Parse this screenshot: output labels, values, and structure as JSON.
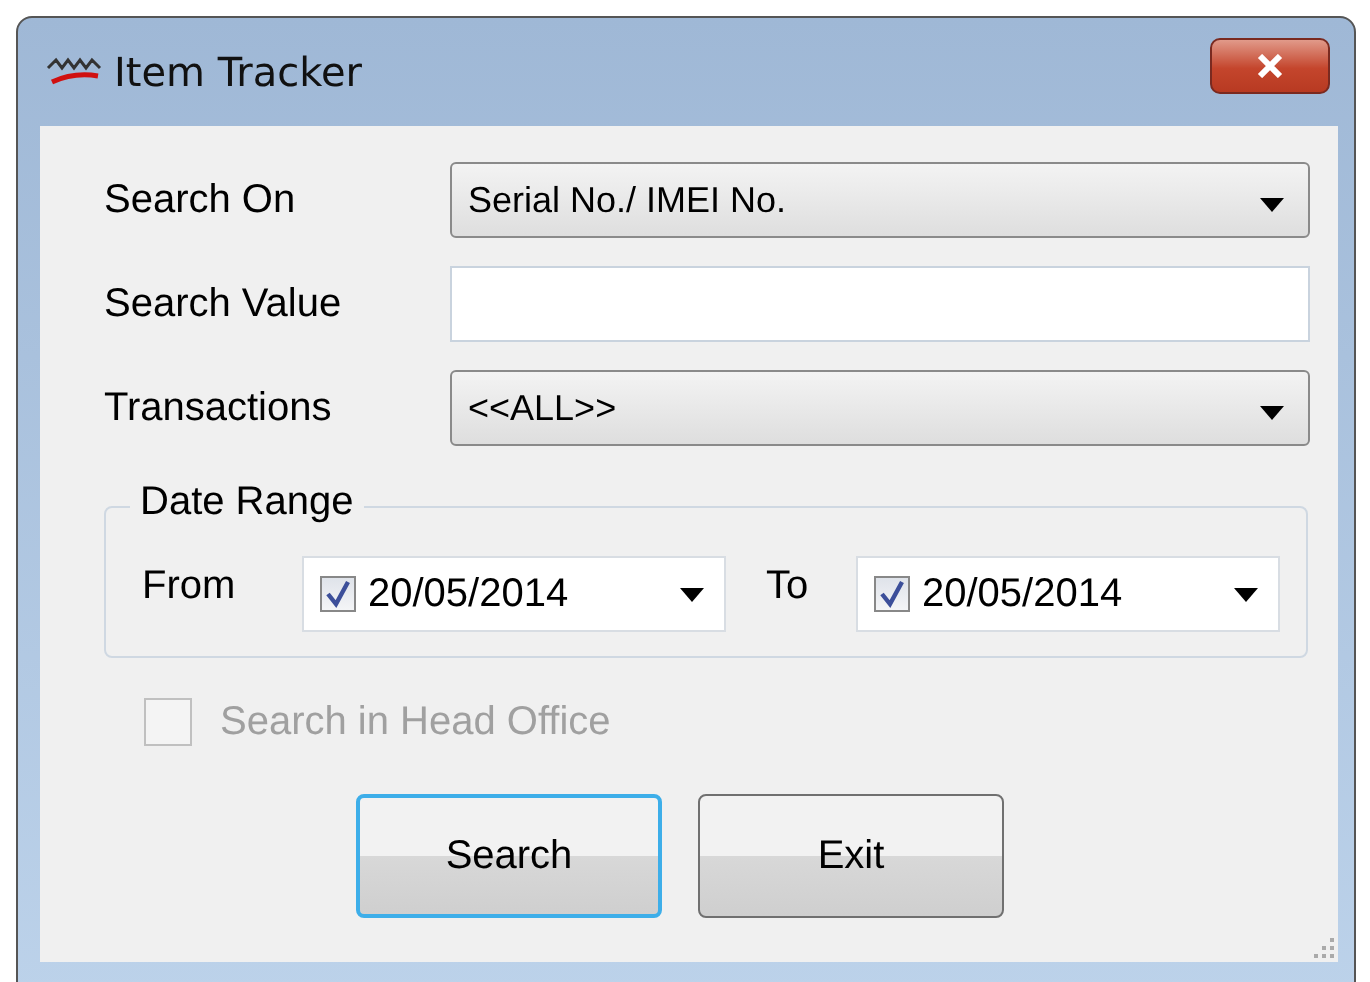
{
  "window": {
    "title": "Item Tracker"
  },
  "fields": [
    {
      "kind": "dropdown",
      "label": "Search On",
      "value": "Serial No./ IMEI No."
    },
    {
      "kind": "text",
      "label": "Search Value"
    },
    {
      "kind": "dropdown",
      "label": "Transactions",
      "value": "<<ALL>>"
    }
  ],
  "date_range": {
    "title": "Date Range",
    "from_label": "From",
    "to_label": "To",
    "from": {
      "value": "20/05/2014",
      "checked": true
    },
    "to": {
      "value": "20/05/2014",
      "checked": true
    }
  },
  "head_office": {
    "label": "Search in Head Office",
    "checked": false,
    "disabled": true
  },
  "buttons": [
    {
      "label": "Search",
      "focused": true
    },
    {
      "label": "Exit",
      "focused": false
    }
  ]
}
